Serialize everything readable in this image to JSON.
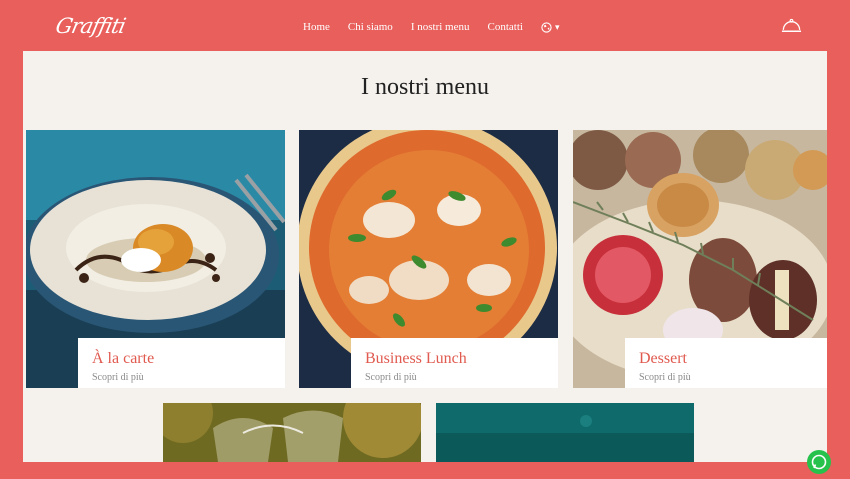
{
  "brand": {
    "logo_text": "Graffiti"
  },
  "nav": {
    "items": [
      {
        "label": "Home"
      },
      {
        "label": "Chi siamo"
      },
      {
        "label": "I nostri menu"
      },
      {
        "label": "Contatti"
      }
    ],
    "language_icon": "globe-icon"
  },
  "header_action_icon": "cloche-icon",
  "main": {
    "title": "I nostri menu",
    "cards": [
      {
        "title": "À la carte",
        "subtitle": "Scopri di più"
      },
      {
        "title": "Business Lunch",
        "subtitle": "Scopri di più"
      },
      {
        "title": "Dessert",
        "subtitle": "Scopri di più"
      }
    ]
  },
  "colors": {
    "brand_red": "#e95f5b",
    "card_title": "#e05a4f",
    "panel_bg": "#f5f1ec",
    "whatsapp_green": "#27c24c"
  },
  "floating_icon": "whatsapp-icon"
}
